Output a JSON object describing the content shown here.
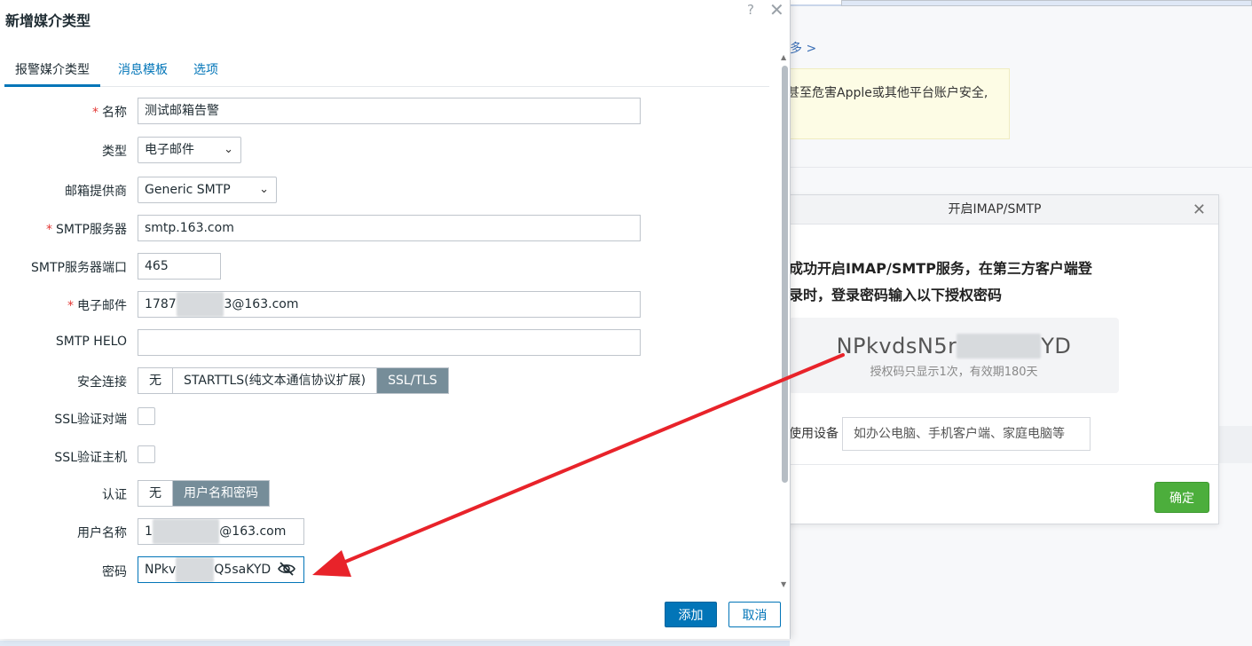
{
  "background": {
    "more_link": "多 >",
    "notice_text": "甚至危害Apple或其他平台账户安全,"
  },
  "imap_dialog": {
    "title": "开启IMAP/SMTP",
    "close_glyph": "✕",
    "message_line1": "成功开启IMAP/SMTP服务，在第三方客户端登",
    "message_line2": "录时，登录密码输入以下授权密码",
    "auth_code_prefix": "NPkvdsN5r",
    "auth_code_masked": "▒▒▒▒▒",
    "auth_code_suffix": "YD",
    "auth_note": "授权码只显示1次，有效期180天",
    "device_label": "使用设备",
    "device_placeholder": "如办公电脑、手机客户端、家庭电脑等",
    "confirm_label": "确定"
  },
  "modal": {
    "title": "新增媒介类型",
    "help_glyph": "?",
    "close_glyph": "✕",
    "tabs": [
      {
        "label": "报警媒介类型",
        "active": true
      },
      {
        "label": "消息模板",
        "active": false
      },
      {
        "label": "选项",
        "active": false
      }
    ],
    "required_mark": "*",
    "fields": {
      "name": {
        "label": "名称",
        "value": "测试邮箱告警"
      },
      "type": {
        "label": "类型",
        "value": "电子邮件"
      },
      "provider": {
        "label": "邮箱提供商",
        "value": "Generic SMTP"
      },
      "smtp_server": {
        "label": "SMTP服务器",
        "value": "smtp.163.com"
      },
      "smtp_port": {
        "label": "SMTP服务器端口",
        "value": "465"
      },
      "email": {
        "label": "电子邮件",
        "value_prefix": "1787",
        "value_masked": "▒▒▒▒▒",
        "value_suffix": "3@163.com"
      },
      "smtp_helo": {
        "label": "SMTP HELO",
        "value": ""
      },
      "security": {
        "label": "安全连接",
        "options": [
          "无",
          "STARTTLS(纯文本通信协议扩展)",
          "SSL/TLS"
        ],
        "selected": "SSL/TLS"
      },
      "ssl_verify_peer": {
        "label": "SSL验证对端",
        "checked": false
      },
      "ssl_verify_host": {
        "label": "SSL验证主机",
        "checked": false
      },
      "auth": {
        "label": "认证",
        "options": [
          "无",
          "用户名和密码"
        ],
        "selected": "用户名和密码"
      },
      "username": {
        "label": "用户名称",
        "value_prefix": "1",
        "value_masked": "▒▒▒▒▒▒▒",
        "value_suffix": "@163.com"
      },
      "password": {
        "label": "密码",
        "value_prefix": "NPkv",
        "value_masked": "▒▒▒▒",
        "value_suffix": "Q5saKYD"
      }
    },
    "add_label": "添加",
    "cancel_label": "取消"
  },
  "colors": {
    "accent": "#0275b8",
    "segment_selected": "#768d99",
    "confirm_green": "#4cae3c",
    "annotation_arrow": "#e8232a",
    "required": "#e33734"
  },
  "icons": [
    "help-icon",
    "close-icon",
    "chevron-down-icon",
    "eye-off-icon",
    "scroll-up-icon",
    "scroll-down-icon"
  ]
}
